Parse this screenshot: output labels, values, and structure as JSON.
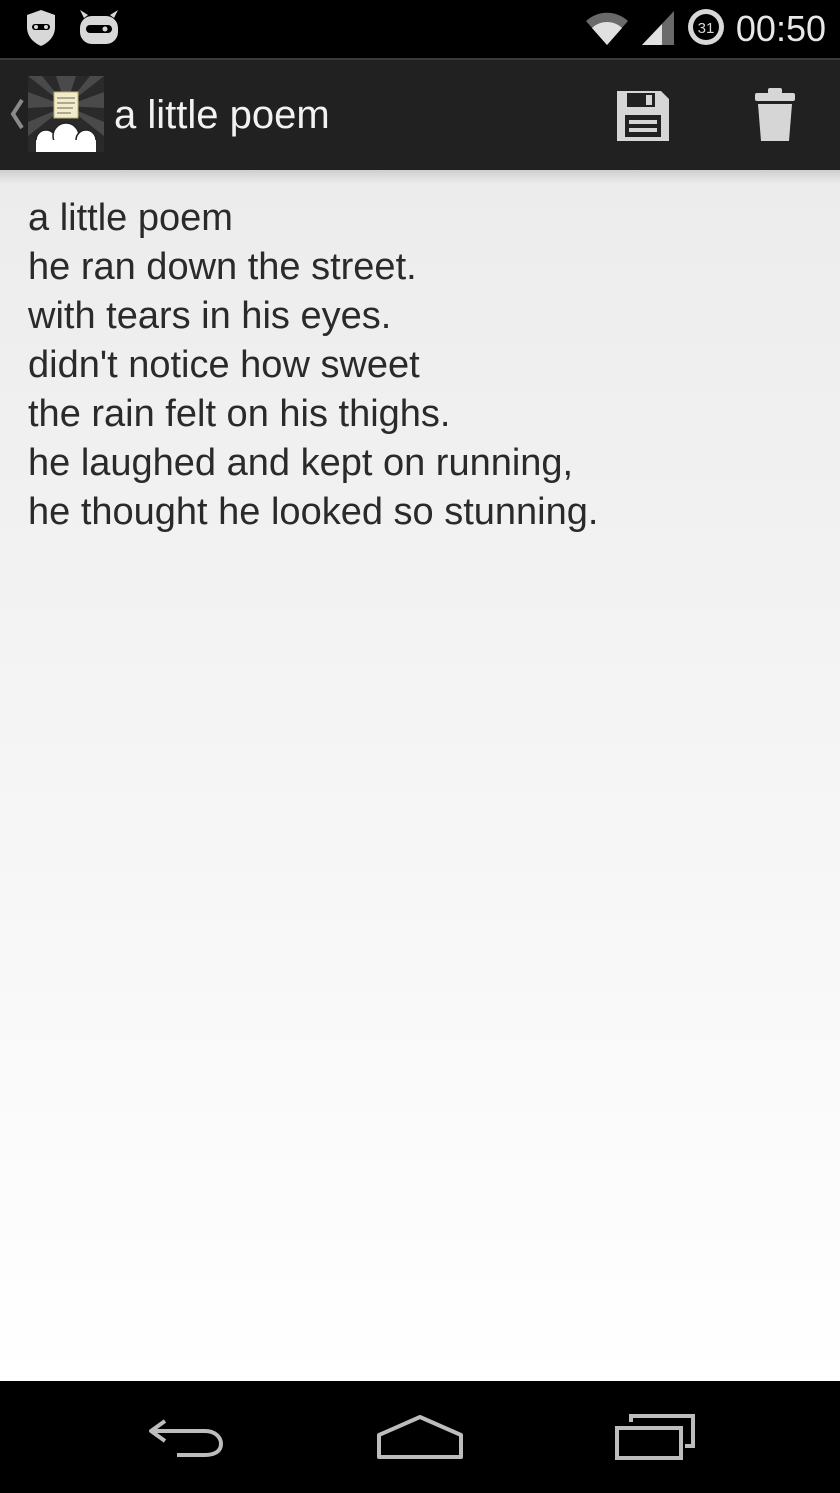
{
  "status_bar": {
    "time": "00:50",
    "calendar_day": "31",
    "icons": [
      "shield-icon",
      "cyanogenmod-icon",
      "wifi-icon",
      "cell-signal-icon",
      "calendar-badge-icon"
    ]
  },
  "action_bar": {
    "title": "a little poem",
    "actions": [
      "save-icon",
      "trash-icon"
    ]
  },
  "note": {
    "lines": [
      "a little poem",
      "he ran down the street.",
      "with tears in his eyes.",
      "didn't notice how sweet",
      "the rain felt on his thighs.",
      "he laughed and kept on running,",
      "he thought he looked so stunning."
    ]
  },
  "nav_bar": {
    "buttons": [
      "back-icon",
      "home-icon",
      "recents-icon"
    ]
  },
  "colors": {
    "action_bar_bg": "#212121",
    "status_bar_bg": "#000000",
    "text": "#2a2a2a"
  }
}
